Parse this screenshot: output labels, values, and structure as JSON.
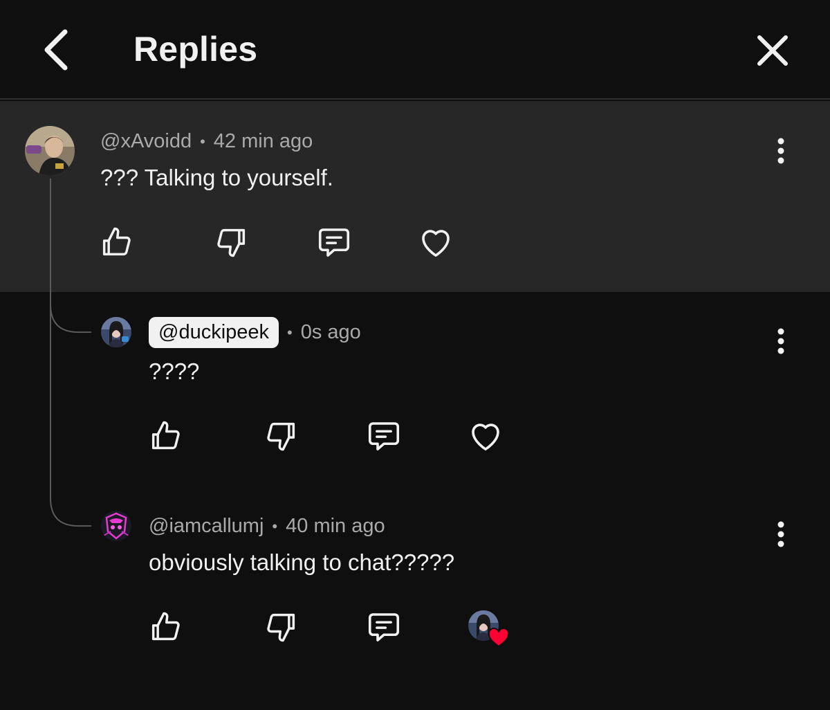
{
  "header": {
    "title": "Replies"
  },
  "comments": [
    {
      "author": "@xAvoidd",
      "separator": "•",
      "time": "42 min ago",
      "text": "??? Talking to yourself."
    },
    {
      "author": "@duckipeek",
      "separator": "•",
      "time": "0s ago",
      "text": "????"
    },
    {
      "author": "@iamcallumj",
      "separator": "•",
      "time": "40 min ago",
      "text": "obviously talking to chat?????"
    }
  ],
  "icons": {
    "back": "chevron-left-icon",
    "close": "close-icon",
    "like": "thumbs-up-icon",
    "dislike": "thumbs-down-icon",
    "reply": "comment-icon",
    "heart": "heart-icon",
    "more": "more-vertical-icon",
    "creator_heart": "creator-heart-badge"
  },
  "colors": {
    "background": "#0f0f0f",
    "parent_background": "#272727",
    "text_primary": "#f1f1f1",
    "text_secondary": "#aaaaaa",
    "heart_badge": "#ff0033"
  }
}
